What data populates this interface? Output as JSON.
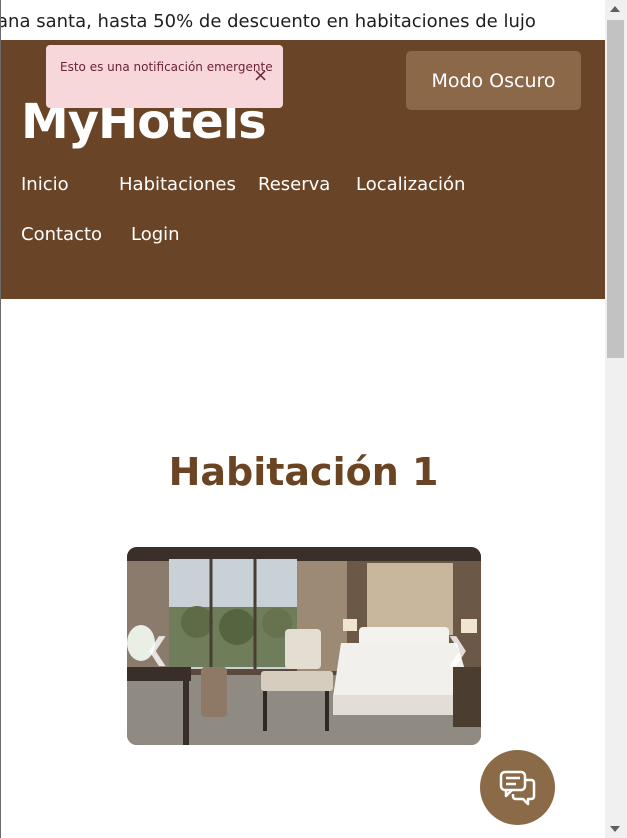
{
  "announcement": {
    "text": "ana santa, hasta 50% de descuento en habitaciones de lujo"
  },
  "header": {
    "brand": "MyHotels",
    "dark_mode_label": "Modo Oscuro",
    "nav": [
      {
        "label": "Inicio"
      },
      {
        "label": "Habitaciones"
      },
      {
        "label": "Reserva"
      },
      {
        "label": "Localización"
      },
      {
        "label": "Contacto"
      },
      {
        "label": "Login"
      }
    ]
  },
  "toast": {
    "message": "Esto es una notificación emergente",
    "close_symbol": "×"
  },
  "main": {
    "room_title": "Habitación 1"
  },
  "carousel": {
    "prev_icon": "chevron-left-icon",
    "next_icon": "chevron-right-icon",
    "prev_symbol": "❮",
    "next_symbol": "❯"
  },
  "chat": {
    "icon": "chat-icon"
  },
  "colors": {
    "header_bg": "#6a4426",
    "accent": "#8a6848",
    "title": "#6b4423",
    "toast_bg": "#f8d7da"
  }
}
